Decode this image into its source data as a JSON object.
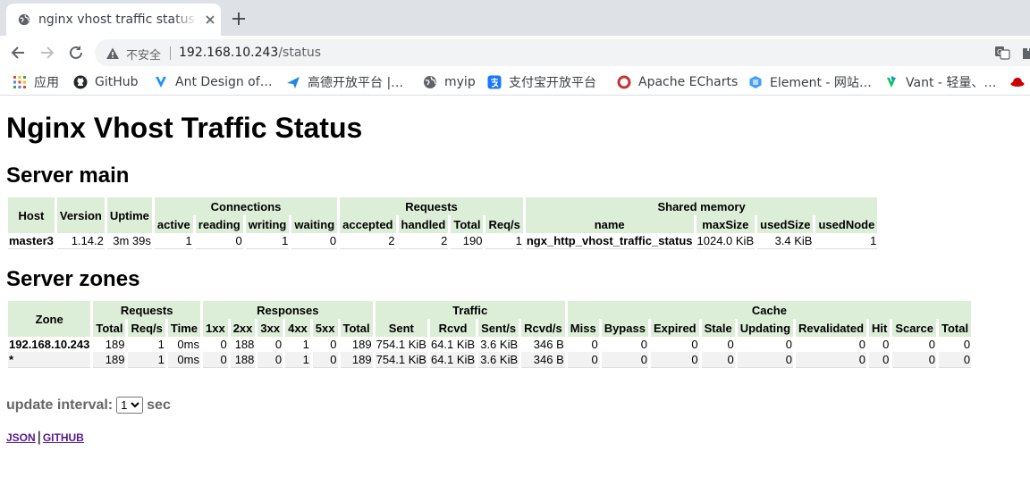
{
  "browser": {
    "tab_title": "nginx vhost traffic status",
    "insecure_label": "不安全",
    "url_host": "192.168.10.243",
    "url_path": "/status",
    "bookmarks": [
      "应用",
      "GitHub",
      "Ant Design of…",
      "高德开放平台 |…",
      "myip",
      "支付宝开放平台",
      "Apache ECharts",
      "Element - 网站…",
      "Vant - 轻量、…"
    ]
  },
  "page": {
    "title": "Nginx Vhost Traffic Status",
    "server_main_heading": "Server main",
    "server_zones_heading": "Server zones",
    "server_main": {
      "headers": {
        "host": "Host",
        "version": "Version",
        "uptime": "Uptime",
        "connections": "Connections",
        "requests": "Requests",
        "shared_memory": "Shared memory",
        "active": "active",
        "reading": "reading",
        "writing": "writing",
        "waiting": "waiting",
        "accepted": "accepted",
        "handled": "handled",
        "total": "Total",
        "reqs": "Req/s",
        "name": "name",
        "maxsize": "maxSize",
        "usedsize": "usedSize",
        "usednode": "usedNode"
      },
      "row": {
        "host": "master3",
        "version": "1.14.2",
        "uptime": "3m 39s",
        "active": "1",
        "reading": "0",
        "writing": "1",
        "waiting": "0",
        "accepted": "2",
        "handled": "2",
        "total": "190",
        "reqs": "1",
        "name": "ngx_http_vhost_traffic_status",
        "maxsize": "1024.0 KiB",
        "usedsize": "3.4 KiB",
        "usednode": "1"
      }
    },
    "server_zones": {
      "headers": {
        "zone": "Zone",
        "requests": "Requests",
        "responses": "Responses",
        "traffic": "Traffic",
        "cache": "Cache",
        "total": "Total",
        "reqs": "Req/s",
        "time": "Time",
        "r1xx": "1xx",
        "r2xx": "2xx",
        "r3xx": "3xx",
        "r4xx": "4xx",
        "r5xx": "5xx",
        "rtotal": "Total",
        "sent": "Sent",
        "rcvd": "Rcvd",
        "sents": "Sent/s",
        "rcvds": "Rcvd/s",
        "miss": "Miss",
        "bypass": "Bypass",
        "expired": "Expired",
        "stale": "Stale",
        "updating": "Updating",
        "revalidated": "Revalidated",
        "hit": "Hit",
        "scarce": "Scarce",
        "ctotal": "Total"
      },
      "rows": [
        {
          "zone": "192.168.10.243",
          "total": "189",
          "reqs": "1",
          "time": "0ms",
          "r1xx": "0",
          "r2xx": "188",
          "r3xx": "0",
          "r4xx": "1",
          "r5xx": "0",
          "rtotal": "189",
          "sent": "754.1 KiB",
          "rcvd": "64.1 KiB",
          "sents": "3.6 KiB",
          "rcvds": "346 B",
          "miss": "0",
          "bypass": "0",
          "expired": "0",
          "stale": "0",
          "updating": "0",
          "revalidated": "0",
          "hit": "0",
          "scarce": "0",
          "ctotal": "0"
        },
        {
          "zone": "*",
          "total": "189",
          "reqs": "1",
          "time": "0ms",
          "r1xx": "0",
          "r2xx": "188",
          "r3xx": "0",
          "r4xx": "1",
          "r5xx": "0",
          "rtotal": "189",
          "sent": "754.1 KiB",
          "rcvd": "64.1 KiB",
          "sents": "3.6 KiB",
          "rcvds": "346 B",
          "miss": "0",
          "bypass": "0",
          "expired": "0",
          "stale": "0",
          "updating": "0",
          "revalidated": "0",
          "hit": "0",
          "scarce": "0",
          "ctotal": "0"
        }
      ]
    },
    "update_interval_label": "update interval:",
    "update_interval_value": "1",
    "update_interval_unit": "sec",
    "json_link": "JSON",
    "link_separator": "|",
    "github_link": "GITHUB"
  },
  "colors": {
    "header_bg": "#dcedd8",
    "alt_row_bg": "#f2f2f2",
    "link": "#551a8b"
  },
  "icons": [
    "globe-icon",
    "close-icon",
    "plus-icon",
    "back-icon",
    "forward-icon",
    "reload-icon",
    "warning-icon",
    "translate-icon",
    "apps-icon",
    "github-icon",
    "antd-icon",
    "amap-icon",
    "myip-icon",
    "alipay-icon",
    "echarts-icon",
    "element-icon",
    "vant-icon"
  ]
}
